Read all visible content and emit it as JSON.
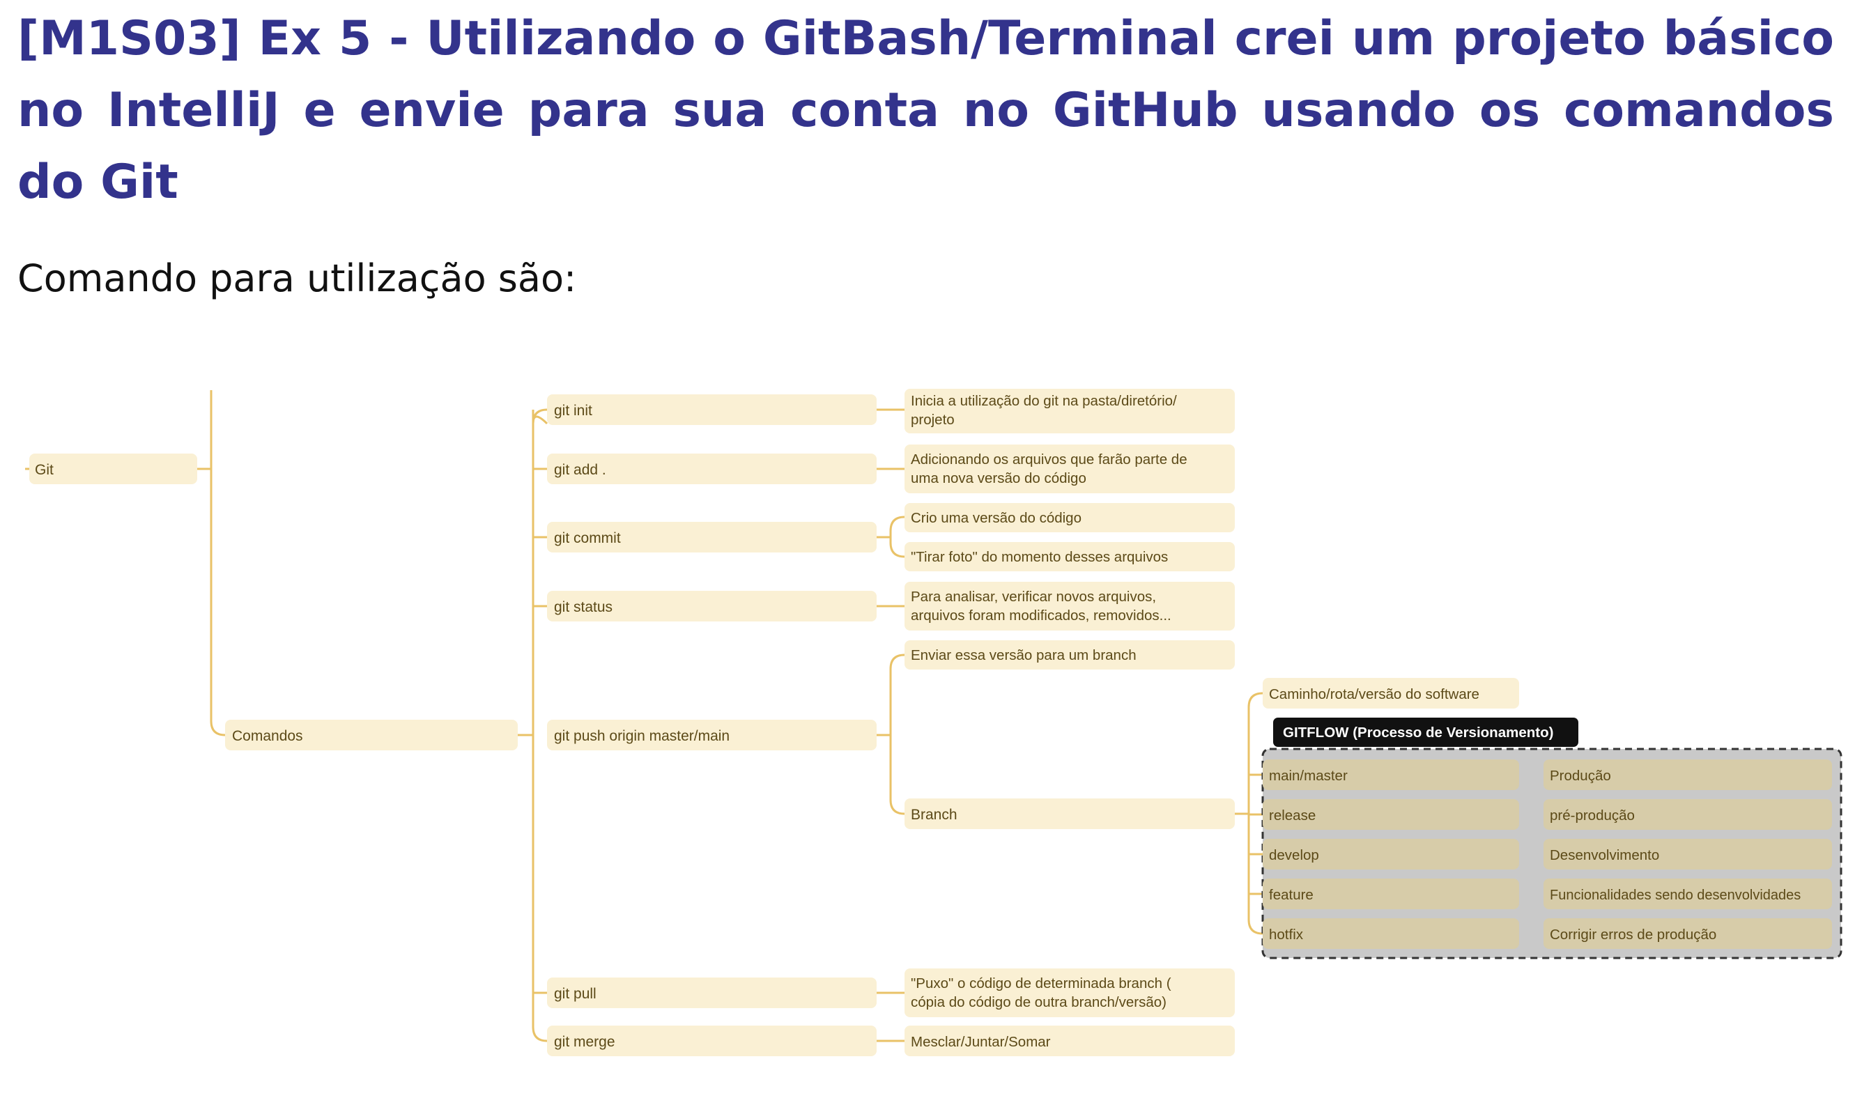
{
  "document": {
    "title": "[M1S03] Ex 5 - Utilizando o GitBash/Terminal crei um projeto básico no IntelliJ e envie para sua conta no GitHub usando os comandos do Git",
    "intro": "Comando para utilização são:"
  },
  "mindmap": {
    "colors": {
      "node": "#faf0d4",
      "line": "#e9c267",
      "text": "#5c4a18",
      "gitflow_node": "#d7cca9",
      "gitflow_area": "#c9c9c9",
      "gitflow_header": "#111111"
    },
    "root": "Git",
    "branch": "Comandos",
    "commands": [
      {
        "label": "git init",
        "descriptions": [
          "Inicia a utilização do git na pasta/diretório/\nprojeto"
        ]
      },
      {
        "label": "git add .",
        "descriptions": [
          "Adicionando os arquivos que farão parte de\numa nova versão do código"
        ]
      },
      {
        "label": "git commit",
        "descriptions": [
          "Crio uma versão do código",
          "\"Tirar foto\" do momento desses arquivos"
        ]
      },
      {
        "label": "git status",
        "descriptions": [
          "Para analisar, verificar novos arquivos,\narquivos foram modificados, removidos..."
        ]
      },
      {
        "label": "git push origin master/main",
        "descriptions": [
          "Enviar essa versão para um branch",
          "Branch"
        ]
      },
      {
        "label": "git pull",
        "descriptions": [
          "\"Puxo\" o código de determinada branch (\ncópia do código de outra branch/versão)"
        ]
      },
      {
        "label": "git merge",
        "descriptions": [
          "Mesclar/Juntar/Somar"
        ]
      }
    ],
    "branch_note": "Caminho/rota/versão do software",
    "gitflow": {
      "title": "GITFLOW (Processo de Versionamento)",
      "items": [
        {
          "name": "main/master",
          "meaning": "Produção"
        },
        {
          "name": "release",
          "meaning": "pré-produção"
        },
        {
          "name": "develop",
          "meaning": "Desenvolvimento"
        },
        {
          "name": "feature",
          "meaning": "Funcionalidades sendo desenvolvidades"
        },
        {
          "name": "hotfix",
          "meaning": "Corrigir erros de produção"
        }
      ]
    }
  }
}
